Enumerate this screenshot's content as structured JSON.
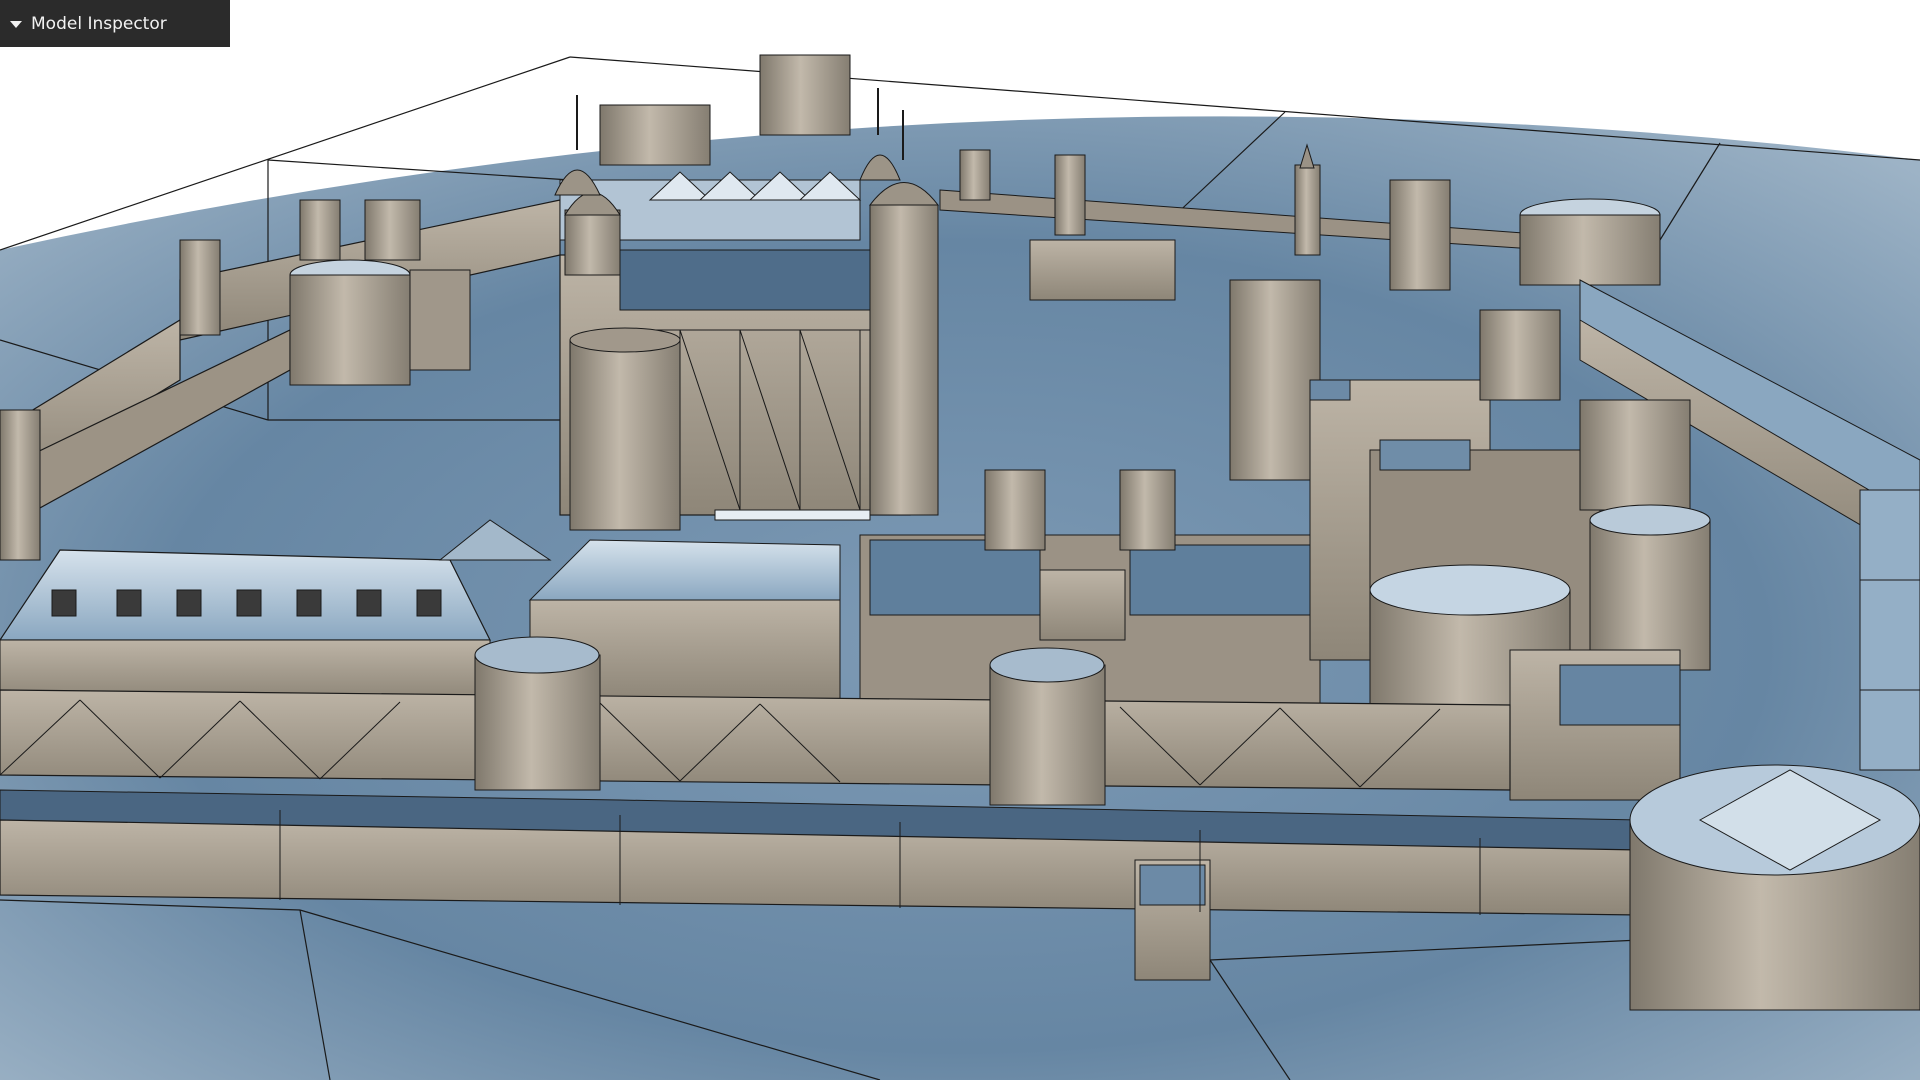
{
  "inspector": {
    "title": "Model Inspector",
    "toggle_icon": "caret-down-icon",
    "expanded": false
  },
  "viewport": {
    "scene": "3d-model-wireframe-overlay",
    "colors": {
      "ground": "#6a8aa8",
      "ground_dark": "#4f6d8a",
      "stone": "#a59c8e",
      "stone_light": "#c4bcb0",
      "roof": "#7f9fbc",
      "roof_light": "#c9d8e6",
      "edges": "#1a1a1a",
      "panel_bg": "#2b2b2b",
      "panel_text": "#f2f2f2"
    }
  }
}
